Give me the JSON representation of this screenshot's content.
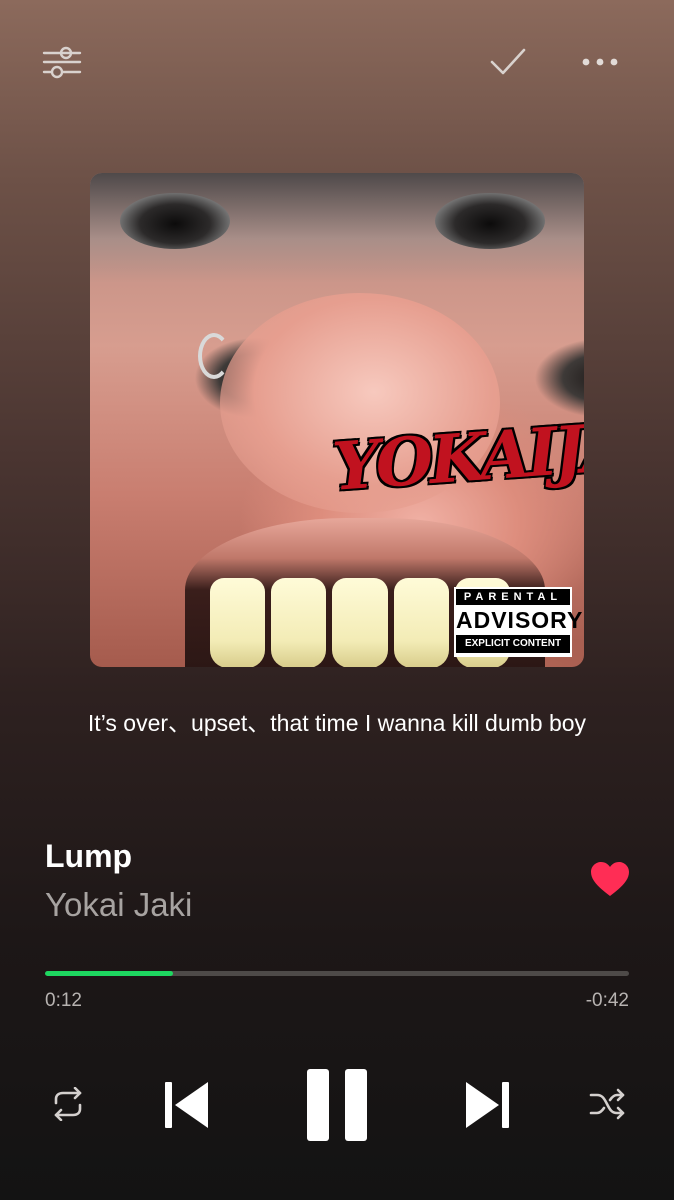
{
  "header": {
    "equalizer_icon": "sliders-icon",
    "confirm_icon": "check-icon",
    "more_icon": "more-dots-icon"
  },
  "artwork": {
    "logo_text": "YOKAIJAKI",
    "advisory": {
      "top": "PARENTAL",
      "middle": "ADVISORY",
      "bottom": "EXPLICIT CONTENT"
    }
  },
  "lyrics": {
    "current_line": "It’s over、upset、that time I wanna kill dumb boy"
  },
  "track": {
    "title": "Lump",
    "artist": "Yokai Jaki",
    "liked": true
  },
  "playback": {
    "elapsed": "0:12",
    "remaining": "-0:42",
    "progress_fraction": 0.22,
    "state": "playing"
  },
  "controls": {
    "repeat_icon": "repeat-icon",
    "previous_icon": "skip-previous-icon",
    "pause_icon": "pause-icon",
    "next_icon": "skip-next-icon",
    "shuffle_icon": "shuffle-icon"
  },
  "colors": {
    "accent": "#1ed760",
    "like": "#ff2d55",
    "secondary_text": "#a7a3a1"
  }
}
